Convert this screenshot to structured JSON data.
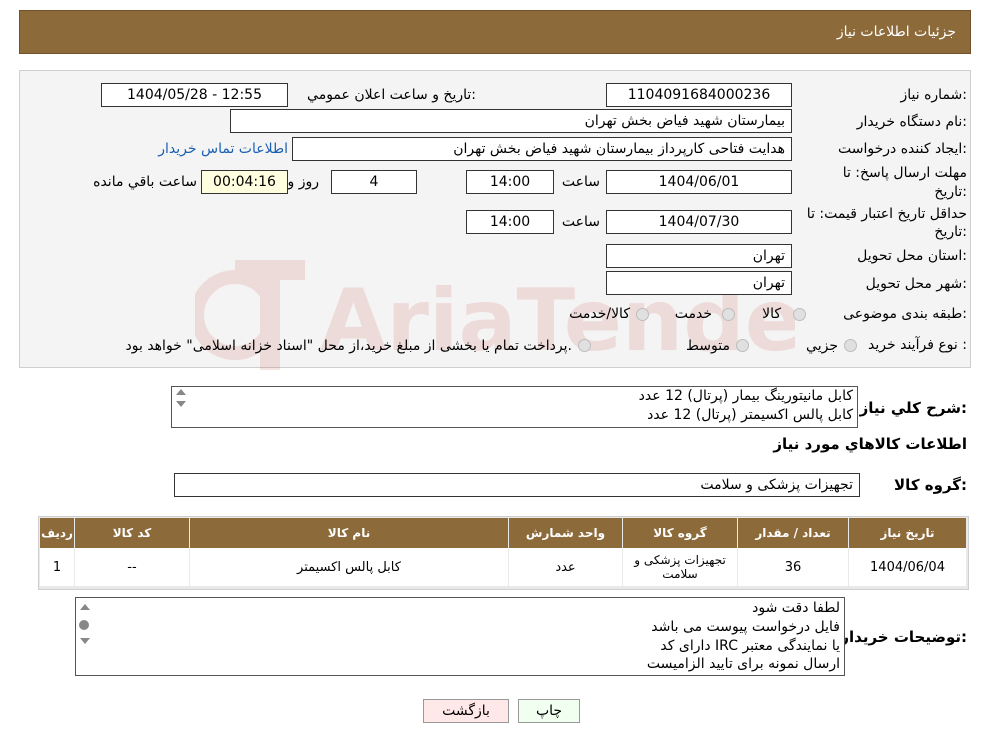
{
  "header": {
    "title": "جزئیات اطلاعات نیاز"
  },
  "fields": {
    "need_number_label": "شماره نیاز:",
    "need_number": "1104091684000236",
    "announce_label": "تاریخ و ساعت اعلان عمومي:",
    "announce_value": "1404/05/28 - 12:55",
    "buyer_org_label": "نام دستگاه خريدار:",
    "buyer_org": "بیمارستان شهید فیاض بخش تهران",
    "creator_label": "ایجاد کننده درخواست:",
    "creator": "هدایت فتاحی کارپرداز بیمارستان شهید فیاض بخش تهران",
    "contact_link": "اطلاعات تماس خریدار",
    "deadline_label_1": "مهلت ارسال پاسخ: تا",
    "deadline_label_2": "تاریخ:",
    "deadline_date": "1404/06/01",
    "time_label": "ساعت",
    "deadline_time": "14:00",
    "days": "4",
    "days_label": "روز و",
    "remaining": "00:04:16",
    "remaining_label": "ساعت باقي مانده",
    "validity_label_1": "حداقل تاریخ اعتبار قیمت: تا",
    "validity_label_2": "تاریخ:",
    "validity_date": "1404/07/30",
    "validity_time": "14:00",
    "province_label": "استان محل تحویل:",
    "province": "تهران",
    "city_label": "شهر محل تحویل:",
    "city": "تهران",
    "category_label": "طبقه بندی موضوعی:",
    "category_options": [
      "کالا",
      "خدمت",
      "کالا/خدمت"
    ],
    "process_label": "نوع فرآیند خرید :",
    "process_options": [
      "جزیي",
      "متوسط"
    ],
    "process_note": "پرداخت تمام یا بخشی از مبلغ خرید،از محل \"اسناد خزانه اسلامی\" خواهد بود."
  },
  "description": {
    "label": "شرح کلي نياز:",
    "lines": [
      "کابل مانیتورینگ بیمار (پرتال) 12 عدد",
      "کابل پالس اکسیمتر (پرتال) 12 عدد"
    ]
  },
  "goods_info_title": "اطلاعات کالاهاي مورد نياز",
  "goods_group": {
    "label": "گروه کالا:",
    "value": "تجهیزات پزشکی و سلامت"
  },
  "table": {
    "headers": [
      "ردیف",
      "کد کالا",
      "نام کالا",
      "واحد شمارش",
      "گروه کالا",
      "تعداد / مقدار",
      "تاریخ نیاز"
    ],
    "rows": [
      [
        "1",
        "--",
        "کابل پالس اکسیمتر",
        "عدد",
        "تجهیزات پزشکی و سلامت",
        "36",
        "1404/06/04"
      ]
    ]
  },
  "buyer_notes": {
    "label": "توضیحات خریدار:",
    "lines": [
      "لطفا دقت شود",
      "فایل درخواست پیوست می باشد",
      "دارای کد IRC یا نمایندگی معتبر",
      "ارسال نمونه برای تایید الزامیست"
    ]
  },
  "buttons": {
    "print": "چاپ",
    "back": "بازگشت"
  },
  "watermark": "AriaTender.neT",
  "colors": {
    "header": "#8c6a3a",
    "link": "#1a5fb4",
    "print_bg": "#f0fff0",
    "back_bg": "#ffe8e8",
    "remaining_bg": "#ffffe0"
  }
}
